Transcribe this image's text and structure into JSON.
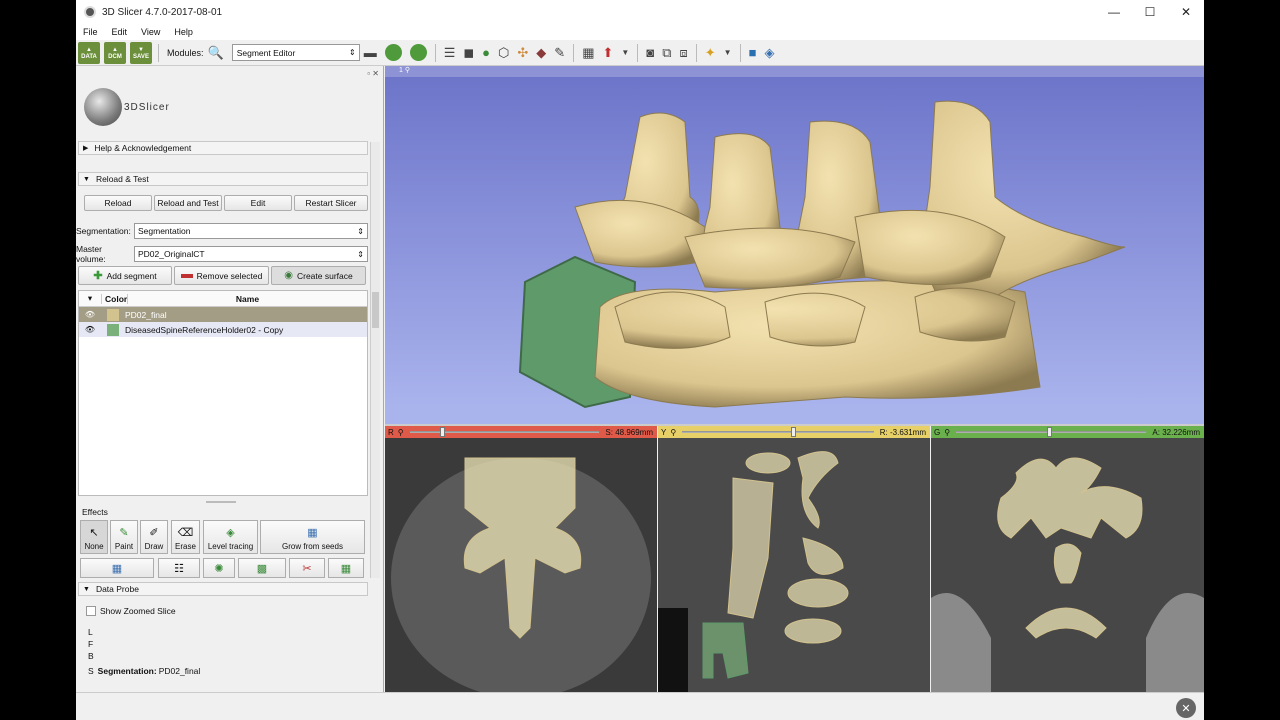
{
  "window": {
    "title": "3D Slicer 4.7.0-2017-08-01",
    "buttons": [
      "—",
      "☐",
      "✕"
    ]
  },
  "menu": [
    "File",
    "Edit",
    "View",
    "Help"
  ],
  "toolbar": {
    "data_labels": [
      "DATA",
      "DCM",
      "SAVE"
    ],
    "modules_label": "Modules:",
    "module_selected": "Segment Editor"
  },
  "logo_text": "3DSlicer",
  "sections": {
    "help": "Help & Acknowledgement",
    "reload": "Reload & Test",
    "data_probe": "Data Probe"
  },
  "reload_buttons": [
    "Reload",
    "Reload and Test",
    "Edit",
    "Restart Slicer"
  ],
  "segmentation": {
    "label": "Segmentation:",
    "value": "Segmentation"
  },
  "master_volume": {
    "label": "Master volume:",
    "value": "PD02_OriginalCT"
  },
  "segment_buttons": {
    "add": "Add segment",
    "remove": "Remove selected",
    "surface": "Create surface"
  },
  "table": {
    "headers": [
      "Color",
      "Name"
    ],
    "rows": [
      {
        "name": "PD02_final",
        "color": "#d2c28e",
        "selected": true
      },
      {
        "name": "DiseasedSpineReferenceHolder02 - Copy",
        "color": "#7ab07a",
        "selected": false
      }
    ]
  },
  "effects": {
    "label": "Effects",
    "buttons": [
      "None",
      "Paint",
      "Draw",
      "Erase",
      "Level tracing",
      "Grow from seeds"
    ]
  },
  "data_probe": {
    "zoom_label": "Show Zoomed Slice",
    "coords": [
      "L",
      "F",
      "B"
    ],
    "seg_prefix": "S",
    "seg_label": "Segmentation:",
    "seg_value": "PD02_final"
  },
  "view3d": {
    "label": "1"
  },
  "slices": [
    {
      "letter": "R",
      "value": "S: 48.969mm",
      "color": "#e05a4a",
      "level": 0.16
    },
    {
      "letter": "Y",
      "value": "R: -3.631mm",
      "color": "#e6d067",
      "level": 0.57
    },
    {
      "letter": "G",
      "value": "A: 32.226mm",
      "color": "#6ab04c",
      "level": 0.48
    }
  ]
}
